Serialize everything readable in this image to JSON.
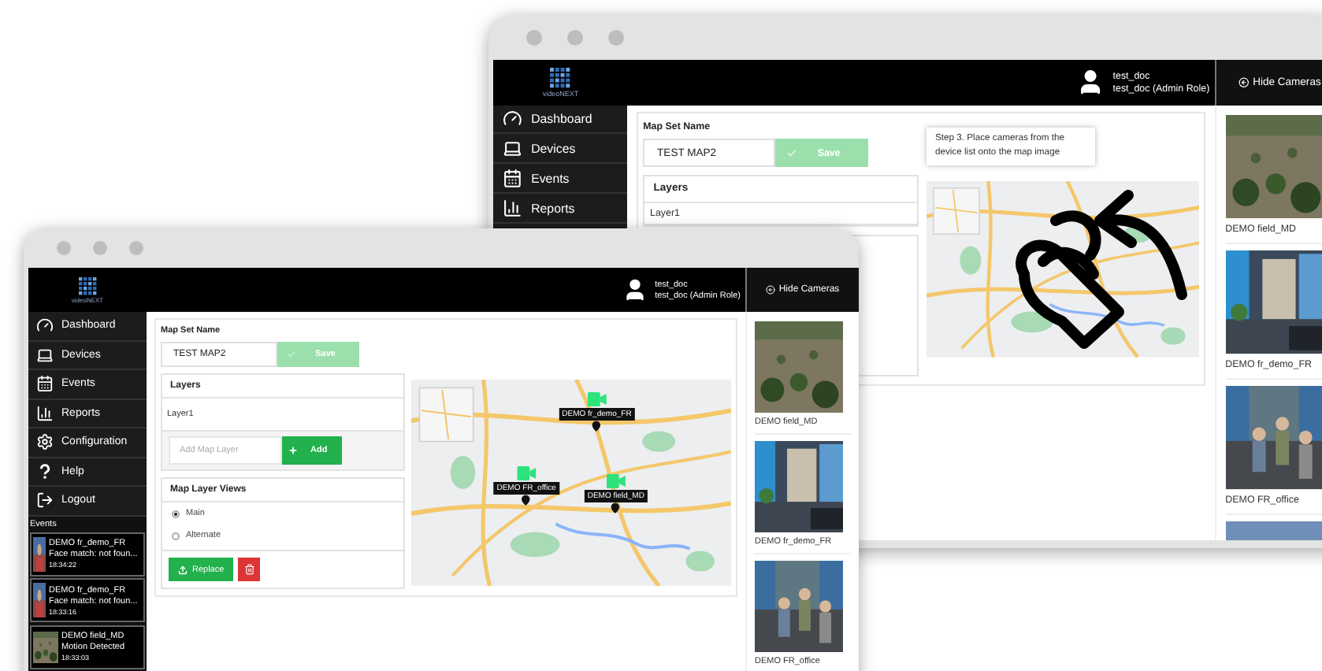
{
  "back_window": {
    "logo": "videoNEXT",
    "header": {
      "user_name": "test_doc",
      "user_role": "test_doc (Admin Role)",
      "hide_cameras": "Hide Cameras"
    },
    "sidebar": [
      {
        "label": "Dashboard",
        "kind": "dashboard"
      },
      {
        "label": "Devices",
        "kind": "devices"
      },
      {
        "label": "Events",
        "kind": "events"
      },
      {
        "label": "Reports",
        "kind": "reports"
      }
    ],
    "map_set": {
      "label": "Map Set Name",
      "value": "TEST MAP2",
      "save": "Save",
      "disabled": true
    },
    "layers": {
      "title": "Layers",
      "items": [
        "Layer1"
      ]
    },
    "tooltip": "Step 3. Place cameras from the device list onto the map image",
    "cameras": [
      {
        "name": "DEMO field_MD",
        "kind": "field"
      },
      {
        "name": "DEMO fr_demo_FR",
        "kind": "office"
      },
      {
        "name": "DEMO FR_office",
        "kind": "room"
      },
      {
        "kind": "parking"
      }
    ]
  },
  "front_window": {
    "logo": "videoNEXT",
    "header": {
      "user_name": "test_doc",
      "user_role": "test_doc (Admin Role)",
      "hide_cameras": "Hide Cameras"
    },
    "sidebar": [
      {
        "label": "Dashboard",
        "kind": "dashboard"
      },
      {
        "label": "Devices",
        "kind": "devices"
      },
      {
        "label": "Events",
        "kind": "events"
      },
      {
        "label": "Reports",
        "kind": "reports"
      },
      {
        "label": "Configuration",
        "kind": "configuration"
      },
      {
        "label": "Help",
        "kind": "help"
      },
      {
        "label": "Logout",
        "kind": "logout"
      }
    ],
    "events": {
      "title": "Events",
      "items": [
        {
          "camera": "DEMO fr_demo_FR",
          "message": "Face match: not foun...",
          "time": "18:34:22",
          "kind": "face"
        },
        {
          "camera": "DEMO fr_demo_FR",
          "message": "Face match: not foun...",
          "time": "18:33:16",
          "kind": "face"
        },
        {
          "camera": "DEMO field_MD",
          "message": "Motion Detected",
          "time": "18:33:03",
          "kind": "field"
        }
      ]
    },
    "map_set": {
      "label": "Map Set Name",
      "value": "TEST MAP2",
      "save": "Save",
      "disabled": true
    },
    "layers": {
      "title": "Layers",
      "items": [
        "Layer1"
      ],
      "add_placeholder": "Add Map Layer",
      "add_button": "Add"
    },
    "views": {
      "title": "Map Layer Views",
      "options": [
        {
          "label": "Main",
          "selected": true
        },
        {
          "label": "Alternate",
          "selected": false
        }
      ],
      "replace": "Replace"
    },
    "markers": [
      {
        "label": "DEMO fr_demo_FR"
      },
      {
        "label": "DEMO FR_office"
      },
      {
        "label": "DEMO field_MD"
      }
    ],
    "cameras": [
      {
        "name": "DEMO field_MD",
        "kind": "field"
      },
      {
        "name": "DEMO fr_demo_FR",
        "kind": "office"
      },
      {
        "name": "DEMO FR_office",
        "kind": "room"
      }
    ]
  }
}
